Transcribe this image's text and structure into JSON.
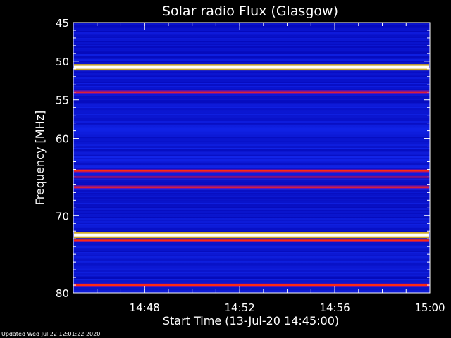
{
  "chart_data": {
    "type": "heatmap",
    "title": "Solar radio Flux (Glasgow)",
    "xlabel": "Start Time (13-Jul-20 14:45:00)",
    "ylabel": "Frequency [MHz]",
    "x_unit": "time",
    "xlim": [
      "14:45",
      "15:00"
    ],
    "x_ticks": [
      "14:48",
      "14:52",
      "14:56",
      "15:00"
    ],
    "ylim": [
      45,
      80
    ],
    "y_reversed": true,
    "y_ticks": [
      45,
      50,
      55,
      60,
      70,
      80
    ],
    "y_tick_labels": [
      "45",
      "50",
      "55",
      "60",
      "70",
      "80"
    ],
    "background_color": "#0a14d8",
    "emission_bands": [
      {
        "freq_mhz": 50.8,
        "intensity": "very high"
      },
      {
        "freq_mhz": 54.0,
        "intensity": "medium"
      },
      {
        "freq_mhz": 64.2,
        "intensity": "medium"
      },
      {
        "freq_mhz": 65.0,
        "intensity": "low"
      },
      {
        "freq_mhz": 66.3,
        "intensity": "medium"
      },
      {
        "freq_mhz": 72.5,
        "intensity": "very high"
      },
      {
        "freq_mhz": 73.2,
        "intensity": "medium"
      },
      {
        "freq_mhz": 79.0,
        "intensity": "medium"
      }
    ],
    "grid": false
  },
  "footer": {
    "updated": "Updated Wed Jul 22 12:01:22 2020"
  }
}
